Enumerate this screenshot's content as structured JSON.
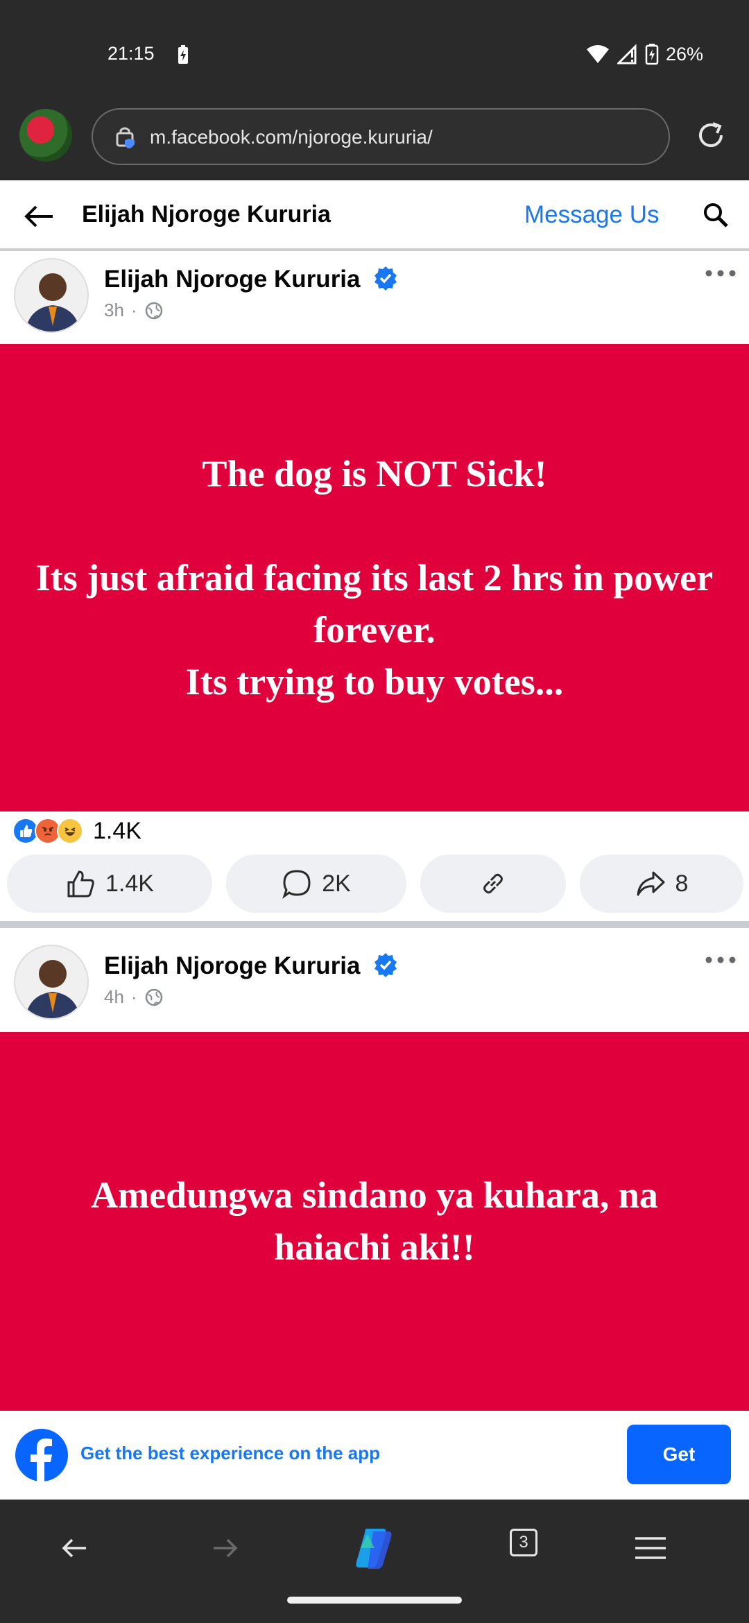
{
  "status_bar": {
    "time": "21:15",
    "battery": "26%"
  },
  "browser": {
    "url": "m.facebook.com/njoroge.kururia/"
  },
  "page_header": {
    "title": "Elijah Njoroge Kururia",
    "message_label": "Message Us"
  },
  "posts": [
    {
      "author": "Elijah Njoroge Kururia",
      "time": "3h",
      "lines": [
        "The dog is NOT Sick!",
        "",
        "Its just afraid facing its last 2 hrs in power forever.",
        "Its trying to buy votes..."
      ],
      "reaction_count": "1.4K",
      "like_count": "1.4K",
      "comment_count": "2K",
      "share_count": "8"
    },
    {
      "author": "Elijah Njoroge Kururia",
      "time": "4h",
      "lines": [
        "Amedungwa sindano ya kuhara, na haiachi aki!!"
      ]
    }
  ],
  "app_banner": {
    "text": "Get the best experience on the app",
    "button": "Get"
  },
  "bottom_nav": {
    "tab_count": "3"
  },
  "colors": {
    "post_bg": "#e0003c",
    "brand": "#1877f2",
    "chrome": "#2a2a2a"
  }
}
